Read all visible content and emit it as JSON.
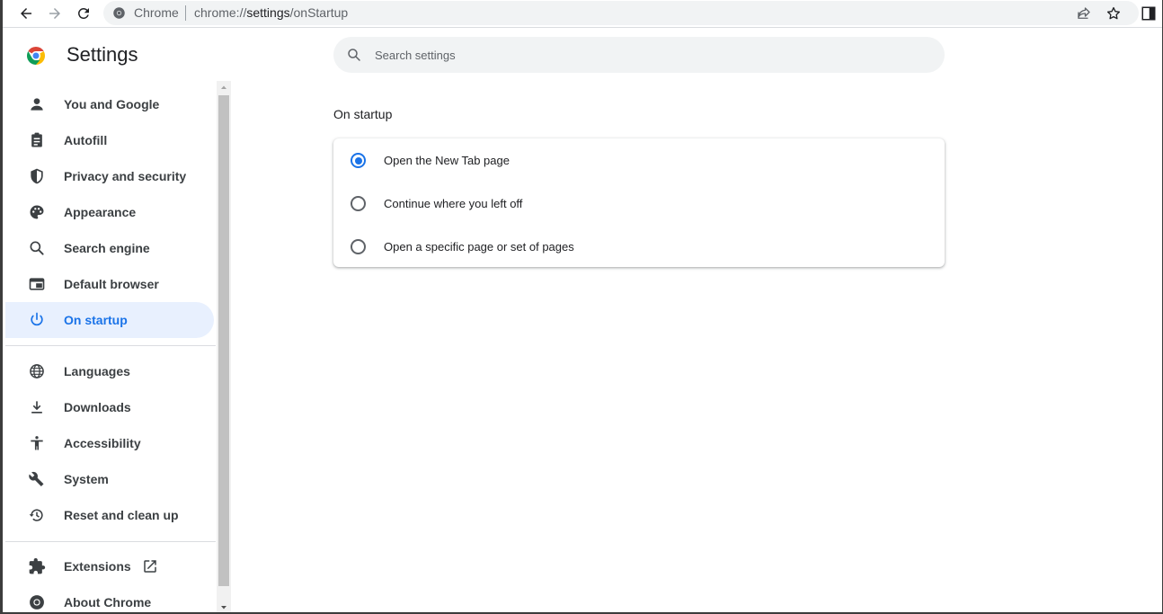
{
  "browser": {
    "origin_label": "Chrome",
    "url_prefix": "chrome://",
    "url_host": "settings",
    "url_path": "/onStartup"
  },
  "header": {
    "title": "Settings"
  },
  "search": {
    "placeholder": "Search settings",
    "value": ""
  },
  "sidebar": {
    "items": [
      {
        "label": "You and Google",
        "icon": "person-icon"
      },
      {
        "label": "Autofill",
        "icon": "clipboard-icon"
      },
      {
        "label": "Privacy and security",
        "icon": "shield-icon"
      },
      {
        "label": "Appearance",
        "icon": "palette-icon"
      },
      {
        "label": "Search engine",
        "icon": "search-icon"
      },
      {
        "label": "Default browser",
        "icon": "browser-window-icon"
      },
      {
        "label": "On startup",
        "icon": "power-icon",
        "active": true
      },
      {
        "label": "Languages",
        "icon": "globe-icon"
      },
      {
        "label": "Downloads",
        "icon": "download-icon"
      },
      {
        "label": "Accessibility",
        "icon": "accessibility-icon"
      },
      {
        "label": "System",
        "icon": "wrench-icon"
      },
      {
        "label": "Reset and clean up",
        "icon": "history-icon"
      },
      {
        "label": "Extensions",
        "icon": "puzzle-icon"
      },
      {
        "label": "About Chrome",
        "icon": "chrome-icon"
      }
    ]
  },
  "main": {
    "section_title": "On startup",
    "options": [
      {
        "label": "Open the New Tab page",
        "checked": true
      },
      {
        "label": "Continue where you left off",
        "checked": false
      },
      {
        "label": "Open a specific page or set of pages",
        "checked": false
      }
    ]
  },
  "colors": {
    "accent": "#1a73e8",
    "active_bg": "#e8f0fe",
    "text": "#202124",
    "muted": "#5f6368"
  }
}
